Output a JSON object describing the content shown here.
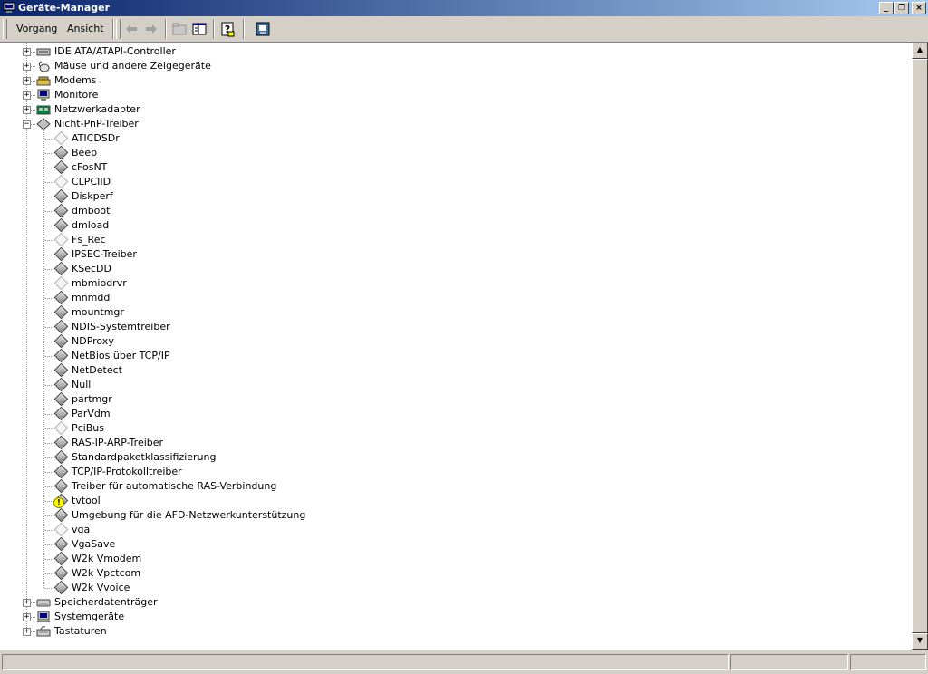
{
  "window": {
    "title": "Geräte-Manager"
  },
  "menu": {
    "vorgang": "Vorgang",
    "ansicht": "Ansicht"
  },
  "tree": {
    "top_before": [
      {
        "label": "IDE ATA/ATAPI-Controller",
        "icon": "ide-controller-icon"
      },
      {
        "label": "Mäuse und andere Zeigegeräte",
        "icon": "mouse-icon"
      },
      {
        "label": "Modems",
        "icon": "modem-icon"
      },
      {
        "label": "Monitore",
        "icon": "monitor-icon"
      },
      {
        "label": "Netzwerkadapter",
        "icon": "network-adapter-icon"
      }
    ],
    "expanded": {
      "label": "Nicht-PnP-Treiber",
      "icon": "non-pnp-driver-icon"
    },
    "children": [
      {
        "label": "ATICDSDr",
        "state": "disabled"
      },
      {
        "label": "Beep",
        "state": "normal"
      },
      {
        "label": "cFosNT",
        "state": "normal"
      },
      {
        "label": "CLPCIID",
        "state": "disabled"
      },
      {
        "label": "Diskperf",
        "state": "normal"
      },
      {
        "label": "dmboot",
        "state": "normal"
      },
      {
        "label": "dmload",
        "state": "normal"
      },
      {
        "label": "Fs_Rec",
        "state": "disabled"
      },
      {
        "label": "IPSEC-Treiber",
        "state": "normal"
      },
      {
        "label": "KSecDD",
        "state": "normal"
      },
      {
        "label": "mbmiodrvr",
        "state": "disabled"
      },
      {
        "label": "mnmdd",
        "state": "normal"
      },
      {
        "label": "mountmgr",
        "state": "normal"
      },
      {
        "label": "NDIS-Systemtreiber",
        "state": "normal"
      },
      {
        "label": "NDProxy",
        "state": "normal"
      },
      {
        "label": "NetBios über TCP/IP",
        "state": "normal"
      },
      {
        "label": "NetDetect",
        "state": "normal"
      },
      {
        "label": "Null",
        "state": "normal"
      },
      {
        "label": "partmgr",
        "state": "normal"
      },
      {
        "label": "ParVdm",
        "state": "normal"
      },
      {
        "label": "PciBus",
        "state": "disabled"
      },
      {
        "label": "RAS-IP-ARP-Treiber",
        "state": "normal"
      },
      {
        "label": "Standardpaketklassifizierung",
        "state": "normal"
      },
      {
        "label": "TCP/IP-Protokolltreiber",
        "state": "normal"
      },
      {
        "label": "Treiber für automatische RAS-Verbindung",
        "state": "normal"
      },
      {
        "label": "tvtool",
        "state": "warning"
      },
      {
        "label": "Umgebung für die AFD-Netzwerkunterstützung",
        "state": "normal"
      },
      {
        "label": "vga",
        "state": "disabled"
      },
      {
        "label": "VgaSave",
        "state": "normal"
      },
      {
        "label": "W2k Vmodem",
        "state": "normal"
      },
      {
        "label": "W2k Vpctcom",
        "state": "normal"
      },
      {
        "label": "W2k Vvoice",
        "state": "normal"
      }
    ],
    "top_after": [
      {
        "label": "Speicherdatenträger",
        "icon": "disk-drive-icon"
      },
      {
        "label": "Systemgeräte",
        "icon": "system-device-icon"
      },
      {
        "label": "Tastaturen",
        "icon": "keyboard-icon"
      }
    ]
  },
  "colors": {
    "title_start": "#0a246a",
    "title_end": "#a6caf0",
    "face": "#d4d0c8",
    "warning": "#ffff00"
  }
}
